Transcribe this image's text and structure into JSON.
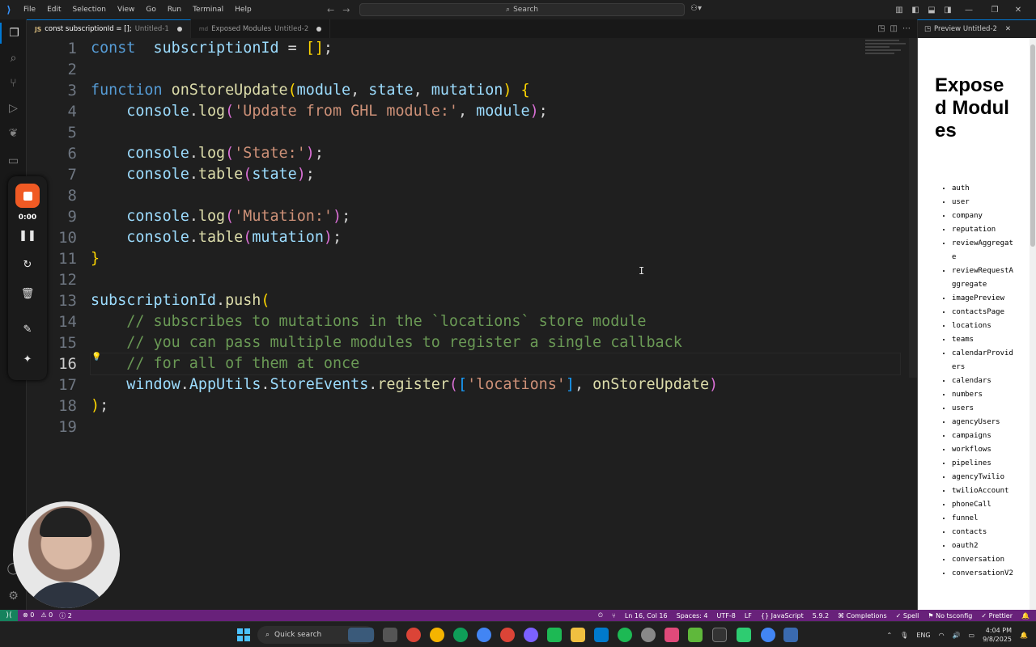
{
  "titlebar": {
    "menu": [
      "File",
      "Edit",
      "Selection",
      "View",
      "Go",
      "Run",
      "Terminal",
      "Help"
    ],
    "search_placeholder": "Search"
  },
  "tabs": [
    {
      "icon": "JS",
      "label": "const subscriptionId = [];",
      "sub": "Untitled-1"
    },
    {
      "icon": "md",
      "label": "Exposed Modules",
      "sub": "Untitled-2"
    }
  ],
  "editor": {
    "line_numbers": [
      "1",
      "2",
      "3",
      "4",
      "5",
      "6",
      "7",
      "8",
      "9",
      "10",
      "11",
      "12",
      "13",
      "14",
      "15",
      "16",
      "17",
      "18",
      "19"
    ],
    "current_line": 16
  },
  "preview": {
    "tab_label": "Preview Untitled-2",
    "heading": "Exposed Modules",
    "modules": [
      "auth",
      "user",
      "company",
      "reputation",
      "reviewAggregate",
      "reviewRequestAggregate",
      "imagePreview",
      "contactsPage",
      "locations",
      "teams",
      "calendarProviders",
      "calendars",
      "numbers",
      "users",
      "agencyUsers",
      "campaigns",
      "workflows",
      "pipelines",
      "agencyTwilio",
      "twilioAccount",
      "phoneCall",
      "funnel",
      "contacts",
      "oauth2",
      "conversation",
      "conversationV2"
    ]
  },
  "recorder": {
    "time": "0:00",
    "accent": "#f05a24"
  },
  "statusbar": {
    "errors": "0",
    "warnings": "0",
    "info": "2",
    "position": "Ln 16, Col 16",
    "spaces": "Spaces: 4",
    "encoding": "UTF-8",
    "eol": "LF",
    "language": "JavaScript",
    "version": "5.9.2",
    "completions": "Completions",
    "spell": "Spell",
    "tsconfig": "No tsconfig",
    "prettier": "Prettier",
    "bg_color": "#68217a"
  },
  "taskbar": {
    "search_label": "Quick search",
    "lang": "ENG",
    "time": "4:04 PM",
    "date": "9/8/2025"
  }
}
